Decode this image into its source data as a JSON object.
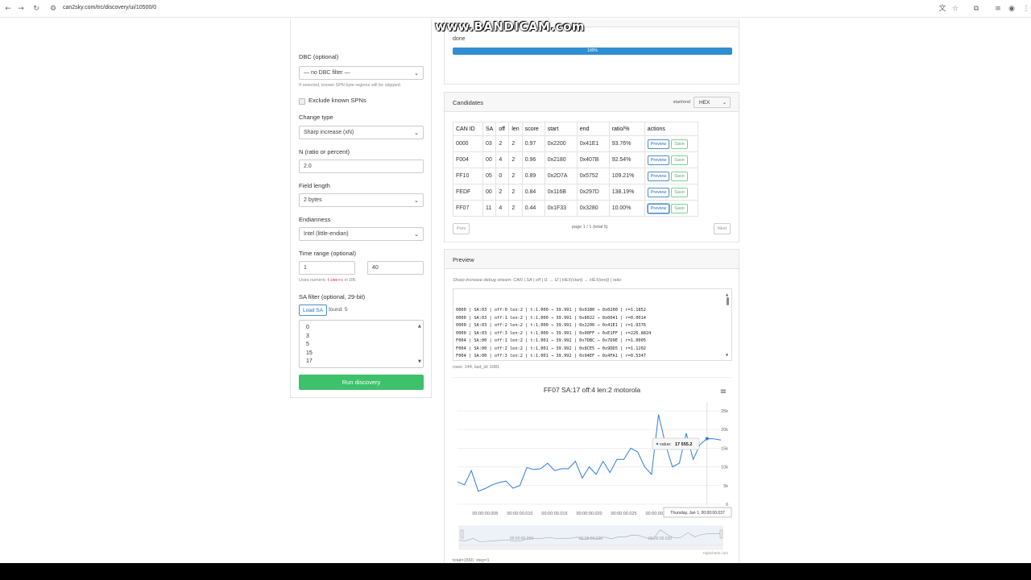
{
  "browser": {
    "url": "can2sky.com/trc/discovery/ui/10500/0",
    "watermark": "www.BANDICAM.com",
    "icons": [
      "back-arrow-icon",
      "forward-arrow-icon",
      "reload-icon",
      "site-info-icon",
      "translate-icon",
      "star-icon",
      "extensions-icon",
      "media-icon",
      "profile-icon",
      "menu-icon"
    ]
  },
  "form": {
    "dbc_label": "DBC (optional)",
    "dbc_value": "— no DBC filter —",
    "dbc_hint": "If selected, known SPN byte regions will be skipped.",
    "exclude_label": "Exclude known SPNs",
    "change_type_label": "Change type",
    "change_type_value": "Sharp increase (xN)",
    "n_label": "N (ratio or percent)",
    "n_value": "2.0",
    "field_length_label": "Field length",
    "field_length_value": "2 bytes",
    "endianness_label": "Endianness",
    "endianness_value": "Intel (little-endian)",
    "time_range_label": "Time range (optional)",
    "time_from": "1",
    "time_to": "40",
    "time_hint_prefix": "Uses numeric ",
    "time_hint_code": "time+s",
    "time_hint_suffix": " in DB.",
    "sa_filter_label": "SA filter (optional, 29-bit)",
    "load_sa_label": "Load SA",
    "found_text": "found: 5",
    "sa_values": [
      "0",
      "3",
      "5",
      "15",
      "17"
    ],
    "run_label": "Run discovery"
  },
  "progress": {
    "status": "done",
    "percent_label": "100%",
    "percent": 100
  },
  "candidates": {
    "title": "Candidates",
    "startend_label": "start/end",
    "startend_value": "HEX",
    "columns": [
      "CAN ID",
      "SA",
      "off",
      "len",
      "score",
      "start",
      "end",
      "ratio/%",
      "actions"
    ],
    "rows": [
      {
        "can_id": "0000",
        "sa": "03",
        "off": "2",
        "len": "2",
        "score": "0.97",
        "start": "0x2200",
        "end": "0x41E1",
        "ratio": "93.76%"
      },
      {
        "can_id": "F004",
        "sa": "00",
        "off": "4",
        "len": "2",
        "score": "0.96",
        "start": "0x2180",
        "end": "0x407B",
        "ratio": "92.54%"
      },
      {
        "can_id": "FF10",
        "sa": "05",
        "off": "0",
        "len": "2",
        "score": "0.89",
        "start": "0x2D7A",
        "end": "0x5752",
        "ratio": "109.21%"
      },
      {
        "can_id": "FEDF",
        "sa": "00",
        "off": "2",
        "len": "2",
        "score": "0.84",
        "start": "0x116B",
        "end": "0x297D",
        "ratio": "138.19%"
      },
      {
        "can_id": "FF07",
        "sa": "11",
        "off": "4",
        "len": "2",
        "score": "0.44",
        "start": "0x1F33",
        "end": "0x3280",
        "ratio": "10.00%"
      }
    ],
    "preview_label": "Preview",
    "save_label": "Save",
    "prev_label": "Prev",
    "next_label": "Next",
    "page_info": "page 1 / 1 (total 5)"
  },
  "preview": {
    "title": "Preview",
    "caption": "Sharp increase debug stream: CAN | SA | off | t1 → t2 | HEX(start) → HEX(end) | ratio",
    "debug_lines": [
      "0000 | SA:03 | off:0 len:2 | t:1.000 → 39.991 | 0x01B0 → 0x0200 | r=1.1852",
      "0000 | SA:03 | off:1 len:2 | t:1.000 → 39.991 | 0x8022 → 0x0041 | r=0.0014",
      "0000 | SA:03 | off:2 len:2 | t:1.000 → 39.991 | 0x2200 → 0x41E1 | r=1.9376",
      "0000 | SA:03 | off:3 len:2 | t:1.000 → 39.991 | 0x00FF → 0xE1FF | r=226.8824",
      "F004 | SA:00 | off:1 len:2 | t:1.001 → 39.992 | 0x7DBC → 0x7D9E | r=1.0005",
      "F004 | SA:00 | off:2 len:2 | t:1.001 → 39.992 | 0x8CE5 → 0x9DD5 | r=1.1202",
      "F004 | SA:00 | off:3 len:2 | t:1.001 → 39.992 | 0x94EF → 0x4FA1 | r=0.5347",
      "F004 | SA:00 | off:4 len:2 | t:1.001 → 39.992 | 0x2180 → 0x407B | r=1.9248",
      "FEF1 | SA:05 | off:0 len:2 | t:1.004 → 39.999 | 0xFF89 → 0xFF8E | r=1.0001"
    ],
    "rows_info": "rows: 144, last_id: 1081",
    "total_info": "total=1560, step=1"
  },
  "chart_data": {
    "type": "line",
    "title": "FF07 SA:17 off:4 len:2 motorola",
    "x_tick_labels": [
      "00:00:00.005",
      "00:00:00.010",
      "00:00:00.015",
      "00:00:00.020",
      "00:00:00.025",
      "00:00:00.030"
    ],
    "y_tick_labels": [
      "0",
      "5k",
      "10k",
      "15k",
      "20k",
      "25k"
    ],
    "ylim": [
      0,
      25000
    ],
    "xlim": [
      0.001,
      0.039
    ],
    "x": [
      0.001,
      0.002,
      0.003,
      0.004,
      0.005,
      0.006,
      0.007,
      0.008,
      0.009,
      0.01,
      0.011,
      0.012,
      0.013,
      0.014,
      0.015,
      0.016,
      0.017,
      0.018,
      0.019,
      0.02,
      0.021,
      0.022,
      0.023,
      0.024,
      0.025,
      0.026,
      0.027,
      0.028,
      0.029,
      0.03,
      0.031,
      0.032,
      0.033,
      0.034,
      0.035,
      0.036,
      0.037,
      0.038,
      0.039
    ],
    "values": [
      6000,
      5200,
      9000,
      3500,
      4200,
      5200,
      5800,
      6200,
      4300,
      5000,
      9800,
      9300,
      9500,
      11000,
      9000,
      9500,
      9500,
      11500,
      7000,
      10000,
      8000,
      11500,
      8500,
      12000,
      12000,
      15000,
      14000,
      10000,
      8000,
      24000,
      16000,
      10000,
      11000,
      19000,
      12000,
      16000,
      17555,
      17500,
      17200
    ],
    "tooltip": {
      "label": "value:",
      "value": "17 555.2"
    },
    "crosshair_label": "Thursday, Jan 1, 00:00:00.037",
    "navigator_labels": [
      "00:00:00.010",
      "00:00:00.020",
      "00:00:00.030"
    ],
    "credits": "Highcharts.com",
    "line_color": "#2f7ed8",
    "grid": true
  }
}
